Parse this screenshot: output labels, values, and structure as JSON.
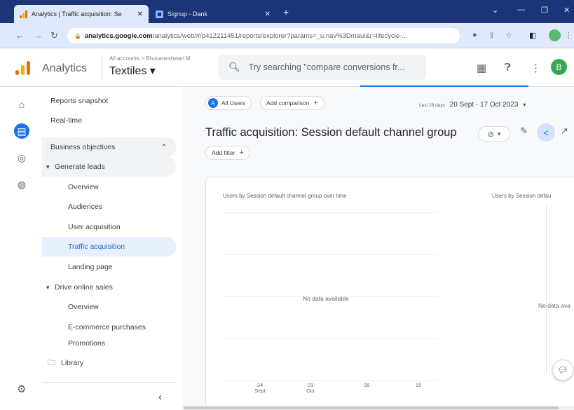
{
  "browser": {
    "tabs": [
      {
        "title": "Analytics | Traffic acquisition: Se",
        "close": "✕"
      },
      {
        "title": "Signup - Dank",
        "close": "✕"
      }
    ],
    "new_tab": "+",
    "url_host": "analytics.google.com",
    "url_path": "/analytics/web/#/p412211451/reports/explorer?params=_u.nav%3Dmaui&r=lifecycle-..."
  },
  "header": {
    "app_name": "Analytics",
    "breadcrumb": "All accounts > Bhuvaneshwari M",
    "property": "Textiles ▾",
    "search_placeholder": "Try searching \"compare conversions fr...",
    "avatar_letter": "B"
  },
  "nav": {
    "reports_snapshot": "Reports snapshot",
    "realtime": "Real-time",
    "section_label": "Business objectives",
    "groups": [
      {
        "label": "Generate leads",
        "items": [
          "Overview",
          "Audiences",
          "User acquisition",
          "Traffic acquisition",
          "Landing page"
        ]
      },
      {
        "label": "Drive online sales",
        "items": [
          "Overview",
          "E-commerce purchases",
          "Promotions"
        ]
      }
    ],
    "library": "Library",
    "selected": "Traffic acquisition"
  },
  "toolbar": {
    "all_users_badge": "A",
    "all_users": "All Users",
    "add_comparison": "Add comparison",
    "date_prefix": "Last 28 days",
    "date_range": "20 Sept - 17 Oct 2023",
    "add_filter": "Add filter"
  },
  "report": {
    "title": "Traffic acquisition: Session default channel group"
  },
  "charts": {
    "left_title": "Users by Session default channel group over time",
    "right_title": "Users by Session defau",
    "left_empty": "No data available",
    "right_empty": "No data ava",
    "xticks": [
      {
        "day": "24",
        "month": "Sept"
      },
      {
        "day": "01",
        "month": "Oct"
      },
      {
        "day": "08",
        "month": ""
      },
      {
        "day": "15",
        "month": ""
      }
    ]
  },
  "colors": {
    "accent": "#1a73e8",
    "browser_frame": "#1c3578",
    "selected_nav_bg": "#e8f0fe",
    "avatar": "#34a853"
  }
}
